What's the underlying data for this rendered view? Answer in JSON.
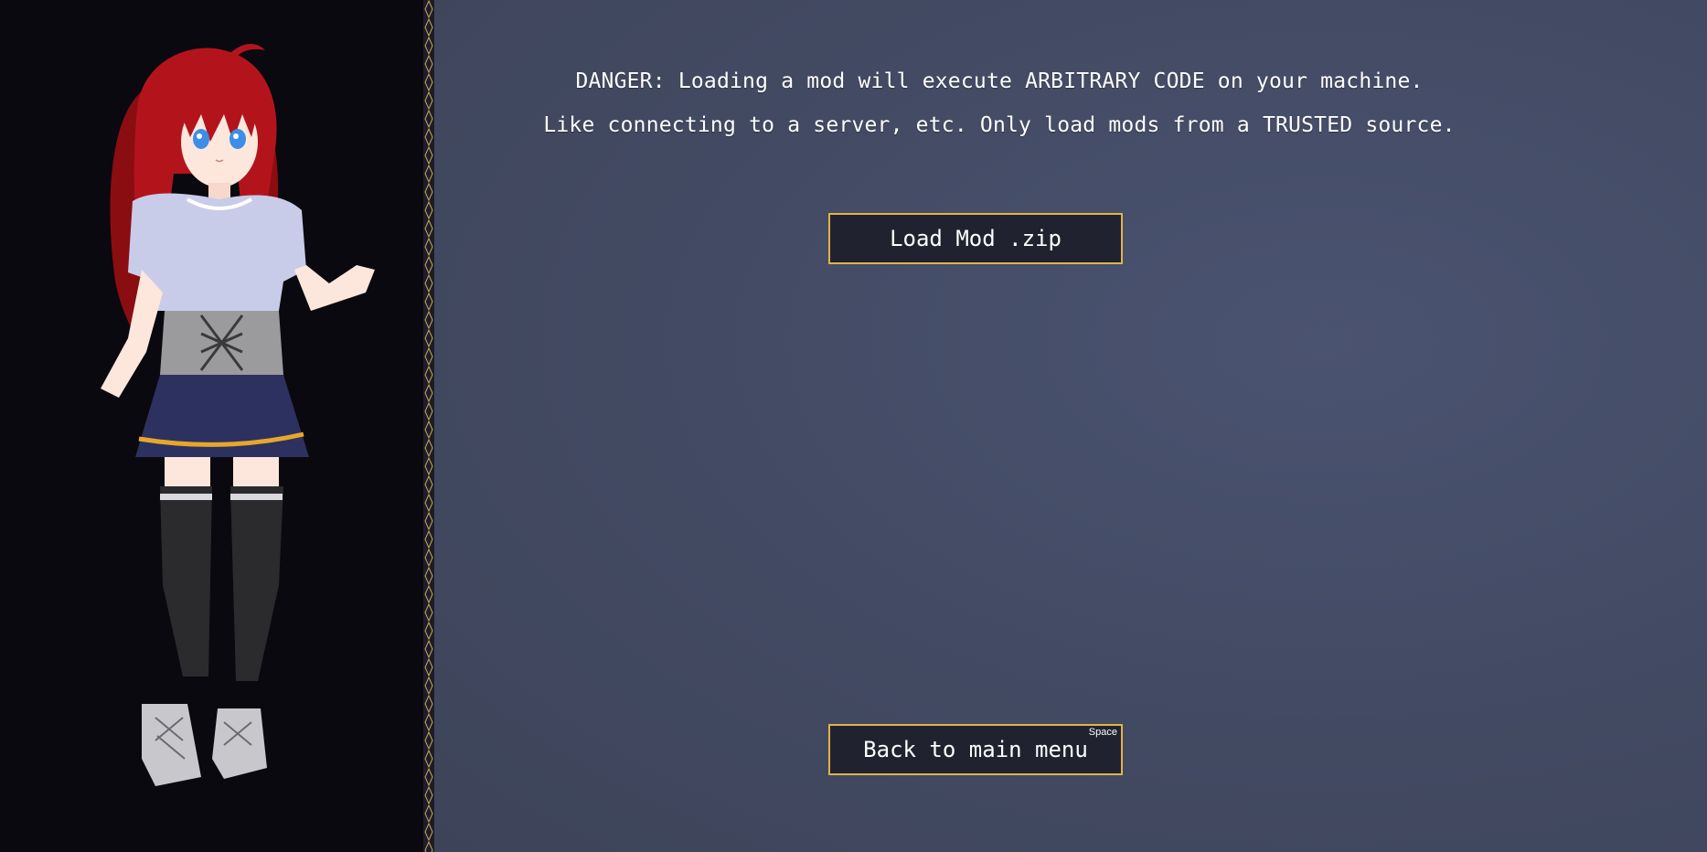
{
  "warning": {
    "line1": "DANGER: Loading a mod will execute ARBITRARY CODE on your machine.",
    "line2": "Like connecting to a server, etc. Only load mods from a TRUSTED source."
  },
  "buttons": {
    "load_mod": "Load Mod .zip",
    "back": "Back to main menu",
    "back_hotkey": "Space"
  },
  "colors": {
    "accent_border": "#e3b24a",
    "button_bg": "#20232f",
    "panel_bg": "#444c66",
    "portrait_bg": "#0a090f"
  },
  "icons": {
    "portrait": "anime-character-portrait",
    "divider": "ornamental-diamond-chain"
  }
}
